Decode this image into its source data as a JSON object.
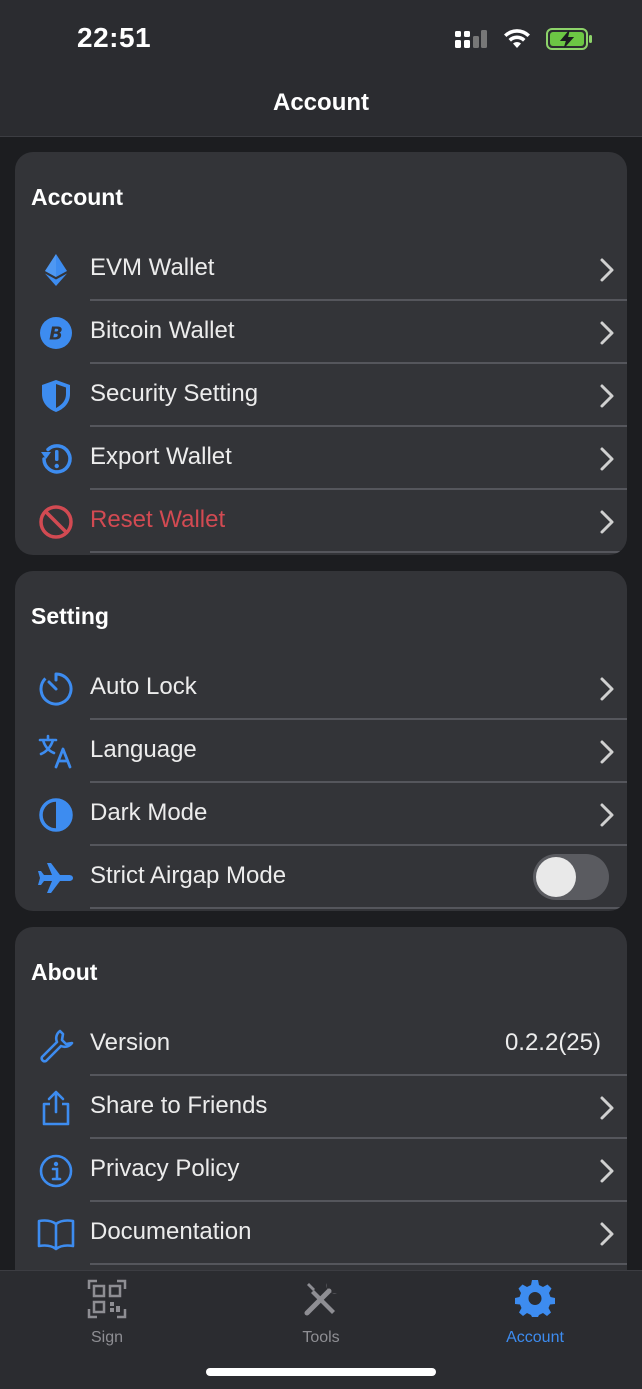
{
  "status_bar": {
    "time": "22:51"
  },
  "nav": {
    "title": "Account"
  },
  "colors": {
    "accent": "#3d8cf0",
    "danger": "#d24a52",
    "card": "#333438",
    "background": "#1c1d20"
  },
  "sections": {
    "account": {
      "title": "Account",
      "items": [
        {
          "label": "EVM Wallet",
          "icon": "ethereum-icon"
        },
        {
          "label": "Bitcoin Wallet",
          "icon": "bitcoin-icon"
        },
        {
          "label": "Security Setting",
          "icon": "shield-icon"
        },
        {
          "label": "Export Wallet",
          "icon": "export-alert-icon"
        },
        {
          "label": "Reset Wallet",
          "icon": "block-icon"
        }
      ]
    },
    "setting": {
      "title": "Setting",
      "items": [
        {
          "label": "Auto Lock",
          "icon": "timer-icon"
        },
        {
          "label": "Language",
          "icon": "translate-icon"
        },
        {
          "label": "Dark Mode",
          "icon": "half-circle-icon"
        },
        {
          "label": "Strict Airgap Mode",
          "icon": "airplane-icon",
          "toggle_on": false
        }
      ]
    },
    "about": {
      "title": "About",
      "items": [
        {
          "label": "Version",
          "icon": "wrench-icon",
          "value": "0.2.2(25)"
        },
        {
          "label": "Share to Friends",
          "icon": "share-icon"
        },
        {
          "label": "Privacy Policy",
          "icon": "info-icon"
        },
        {
          "label": "Documentation",
          "icon": "book-icon"
        }
      ]
    }
  },
  "tabbar": {
    "tabs": [
      {
        "label": "Sign",
        "icon": "qr-code-icon",
        "active": false
      },
      {
        "label": "Tools",
        "icon": "tools-icon",
        "active": false
      },
      {
        "label": "Account",
        "icon": "gear-icon",
        "active": true
      }
    ]
  }
}
